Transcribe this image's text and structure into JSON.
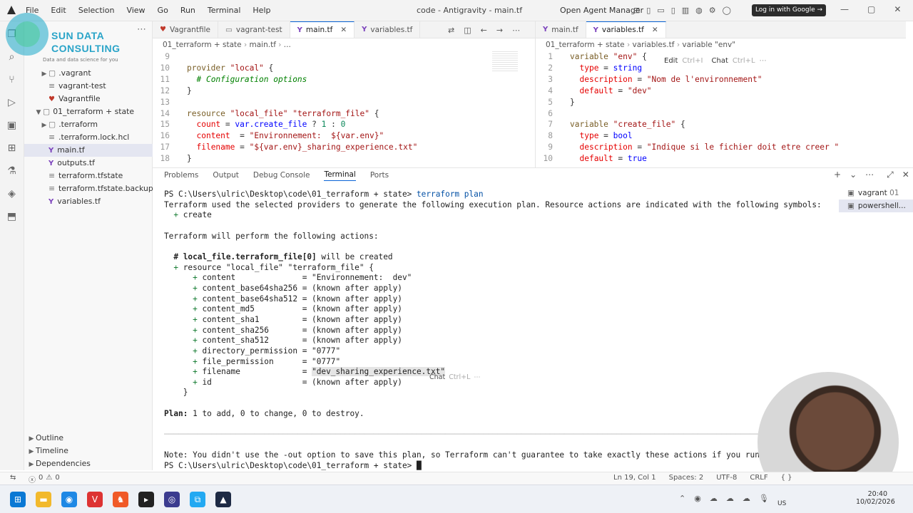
{
  "app": {
    "menu": [
      "File",
      "Edit",
      "Selection",
      "View",
      "Go",
      "Run",
      "Terminal",
      "Help"
    ],
    "window_title": "code - Antigravity - main.tf",
    "agent_manager": "Open Agent Manager",
    "login_button": "Log in with Google →"
  },
  "watermark": {
    "line1": "SUN DATA",
    "line2": "CONSULTING",
    "tagline": "Data and data science for you"
  },
  "sidebar": {
    "items": [
      {
        "label": ".vagrant",
        "type": "folder",
        "indent": 1
      },
      {
        "label": "vagrant-test",
        "type": "file-plain",
        "indent": 1
      },
      {
        "label": "Vagrantfile",
        "type": "vagrant",
        "indent": 1
      },
      {
        "label": "01_terraform + state",
        "type": "folder-open",
        "indent": 0
      },
      {
        "label": ".terraform",
        "type": "folder",
        "indent": 1
      },
      {
        "label": ".terraform.lock.hcl",
        "type": "file-plain",
        "indent": 1
      },
      {
        "label": "main.tf",
        "type": "tf",
        "indent": 1,
        "selected": true
      },
      {
        "label": "outputs.tf",
        "type": "tf",
        "indent": 1
      },
      {
        "label": "terraform.tfstate",
        "type": "file-plain",
        "indent": 1
      },
      {
        "label": "terraform.tfstate.backup",
        "type": "file-plain",
        "indent": 1
      },
      {
        "label": "variables.tf",
        "type": "tf",
        "indent": 1
      }
    ],
    "sections": [
      "Outline",
      "Timeline",
      "Dependencies"
    ]
  },
  "editor_left": {
    "tabs": [
      {
        "label": "Vagrantfile",
        "icon": "vagrant"
      },
      {
        "label": "vagrant-test",
        "icon": "file"
      },
      {
        "label": "main.tf",
        "icon": "tf",
        "active": true,
        "close": "✕"
      },
      {
        "label": "variables.tf",
        "icon": "tf"
      }
    ],
    "breadcrumb": [
      "01_terraform + state",
      "main.tf",
      "..."
    ],
    "lines": [
      {
        "n": "9",
        "html": ""
      },
      {
        "n": "10",
        "html": "<span class='kw'>provider</span> <span class='str'>\"local\"</span> {"
      },
      {
        "n": "11",
        "html": "  <span class='cmt'># Configuration options</span>"
      },
      {
        "n": "12",
        "html": "}"
      },
      {
        "n": "13",
        "html": ""
      },
      {
        "n": "14",
        "html": "<span class='kw'>resource</span> <span class='str'>\"local_file\"</span> <span class='str'>\"terraform_file\"</span> {"
      },
      {
        "n": "15",
        "html": "  <span class='prop'>count</span> = <span class='var'>var.create_file</span> ? <span class='num'>1</span> : <span class='num'>0</span>"
      },
      {
        "n": "16",
        "html": "  <span class='prop'>content</span>  = <span class='str'>\"Environnement:  ${var.env}\"</span>"
      },
      {
        "n": "17",
        "html": "  <span class='prop'>filename</span> = <span class='str'>\"${var.env}_sharing_experience.txt\"</span>"
      },
      {
        "n": "18",
        "html": "}"
      }
    ]
  },
  "editor_right": {
    "tabs": [
      {
        "label": "main.tf",
        "icon": "tf"
      },
      {
        "label": "variables.tf",
        "icon": "tf",
        "active": true,
        "close": "✕"
      }
    ],
    "breadcrumb": [
      "01_terraform + state",
      "variables.tf",
      "variable \"env\""
    ],
    "inline_hint": {
      "edit": "Edit",
      "edit_key": "Ctrl+I",
      "chat": "Chat",
      "chat_key": "Ctrl+L"
    },
    "lines": [
      {
        "n": "1",
        "html": "<span class='kw'>variable</span> <span class='str'>\"env\"</span> {"
      },
      {
        "n": "2",
        "html": "  <span class='prop'>type</span> = <span class='var'>string</span>"
      },
      {
        "n": "3",
        "html": "  <span class='prop'>description</span> = <span class='str'>\"Nom de l'environnement\"</span>"
      },
      {
        "n": "4",
        "html": "  <span class='prop'>default</span> = <span class='str'>\"dev\"</span>"
      },
      {
        "n": "5",
        "html": "}"
      },
      {
        "n": "6",
        "html": ""
      },
      {
        "n": "7",
        "html": "<span class='kw'>variable</span> <span class='str'>\"create_file\"</span> {"
      },
      {
        "n": "8",
        "html": "  <span class='prop'>type</span> = <span class='var'>bool</span>"
      },
      {
        "n": "9",
        "html": "  <span class='prop'>description</span> = <span class='str'>\"Indique si le fichier doit etre creer \"</span>"
      },
      {
        "n": "10",
        "html": "  <span class='prop'>default</span> = <span class='var'>true</span>"
      }
    ]
  },
  "panel": {
    "tabs": [
      "Problems",
      "Output",
      "Debug Console",
      "Terminal",
      "Ports"
    ],
    "active_tab": "Terminal",
    "terminals": [
      {
        "label": "vagrant",
        "suffix": "01"
      },
      {
        "label": "powershell...",
        "suffix": ""
      }
    ],
    "terminal_lines": [
      "PS C:\\Users\\ulric\\Desktop\\code\\01_terraform + state> <span style='color:#0451a5'>terraform plan</span>",
      "Terraform used the selected providers to generate the following execution plan. Resource actions are indicated with the following symbols:",
      "  <span class='plus'>+</span> create",
      "",
      "Terraform will perform the following actions:",
      "",
      "  <b># local_file.terraform_file[0]</b> will be created",
      "  <span class='plus'>+</span> resource \"local_file\" \"terraform_file\" {",
      "      <span class='plus'>+</span> content              = \"Environnement:  dev\"",
      "      <span class='plus'>+</span> content_base64sha256 = (known after apply)",
      "      <span class='plus'>+</span> content_base64sha512 = (known after apply)",
      "      <span class='plus'>+</span> content_md5          = (known after apply)",
      "      <span class='plus'>+</span> content_sha1         = (known after apply)",
      "      <span class='plus'>+</span> content_sha256       = (known after apply)",
      "      <span class='plus'>+</span> content_sha512       = (known after apply)",
      "      <span class='plus'>+</span> directory_permission = \"0777\"",
      "      <span class='plus'>+</span> file_permission      = \"0777\"",
      "      <span class='plus'>+</span> filename             = <span style='background:#e5e5e5'>\"dev_sharing_experience.txt\"</span>",
      "      <span class='plus'>+</span> id                   = (known after apply)",
      "    }",
      "",
      "<b>Plan:</b> 1 to add, 0 to change, 0 to destroy.",
      "",
      "<span style='color:#bbb'>─────────────────────────────────────────────────────────────────────────────────────────────────────────────────────────────────────</span>",
      "",
      "Note: You didn't use the -out option to save this plan, so Terraform can't guarantee to take exactly these actions if you run \"terraform ap",
      "PS C:\\Users\\ulric\\Desktop\\code\\01_terraform + state> █"
    ],
    "inline_chat": {
      "label": "Chat",
      "key": "Ctrl+L"
    }
  },
  "statusbar": {
    "errors": "0",
    "warnings": "0",
    "position": "Ln 19, Col 1",
    "spaces": "Spaces: 2",
    "encoding": "UTF-8",
    "eol": "CRLF",
    "language": "{ }"
  },
  "taskbar": {
    "time": "20:40",
    "date": "10/02/2026",
    "lang": "US"
  }
}
